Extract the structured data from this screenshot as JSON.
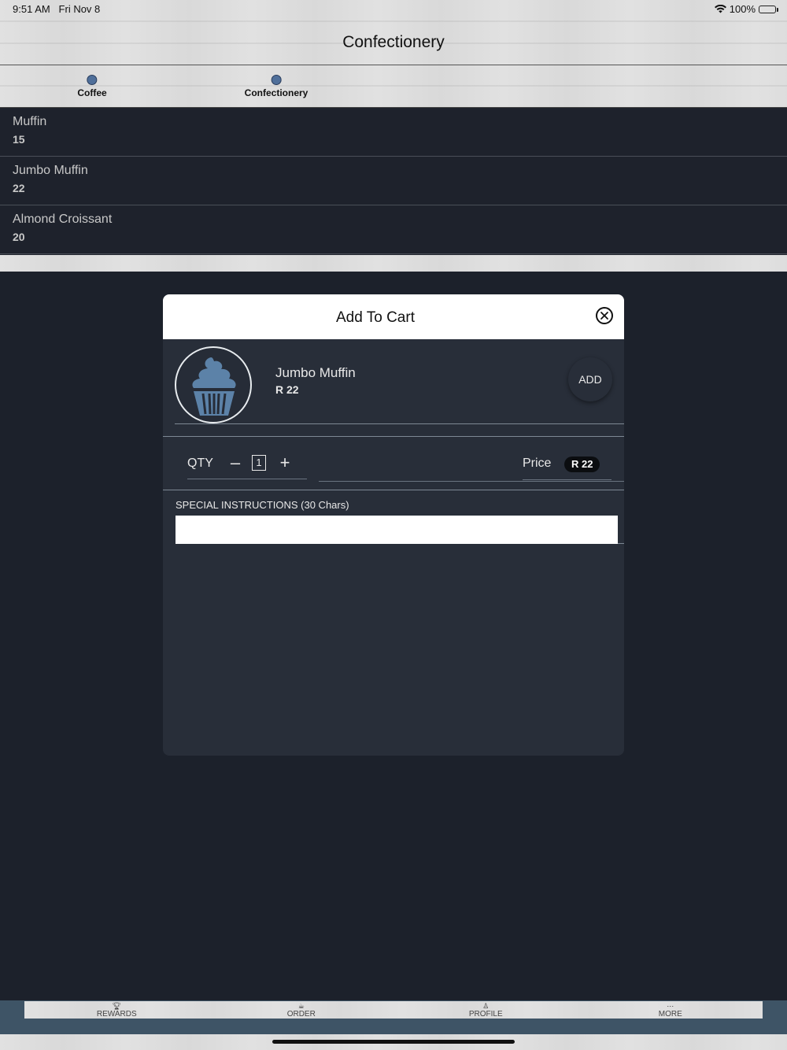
{
  "status_bar": {
    "time": "9:51 AM",
    "date": "Fri Nov 8",
    "battery": "100%"
  },
  "header": {
    "title": "Confectionery"
  },
  "categories": [
    {
      "label": "Coffee"
    },
    {
      "label": "Confectionery"
    }
  ],
  "products": [
    {
      "name": "Muffin",
      "price": "15"
    },
    {
      "name": "Jumbo Muffin",
      "price": "22"
    },
    {
      "name": "Almond Croissant",
      "price": "20"
    }
  ],
  "modal": {
    "title": "Add To Cart",
    "item": {
      "name": "Jumbo Muffin",
      "price": "R 22",
      "add_label": "ADD"
    },
    "qty": {
      "label": "QTY",
      "minus": "–",
      "value": "1",
      "plus": "+"
    },
    "price": {
      "label": "Price",
      "value": "R 22"
    },
    "instructions": {
      "label": "SPECIAL INSTRUCTIONS (30 Chars)",
      "value": ""
    }
  },
  "tabs": [
    {
      "label": "REWARDS",
      "icon": "trophy-icon"
    },
    {
      "label": "ORDER",
      "icon": "coffee-icon"
    },
    {
      "label": "PROFILE",
      "icon": "user-icon"
    },
    {
      "label": "MORE",
      "icon": "more-icon"
    }
  ],
  "colors": {
    "accent": "#4f6f9a",
    "list_bg": "#1e222c",
    "modal_bg": "#282e39",
    "tabbar_bg": "#3e5466"
  }
}
